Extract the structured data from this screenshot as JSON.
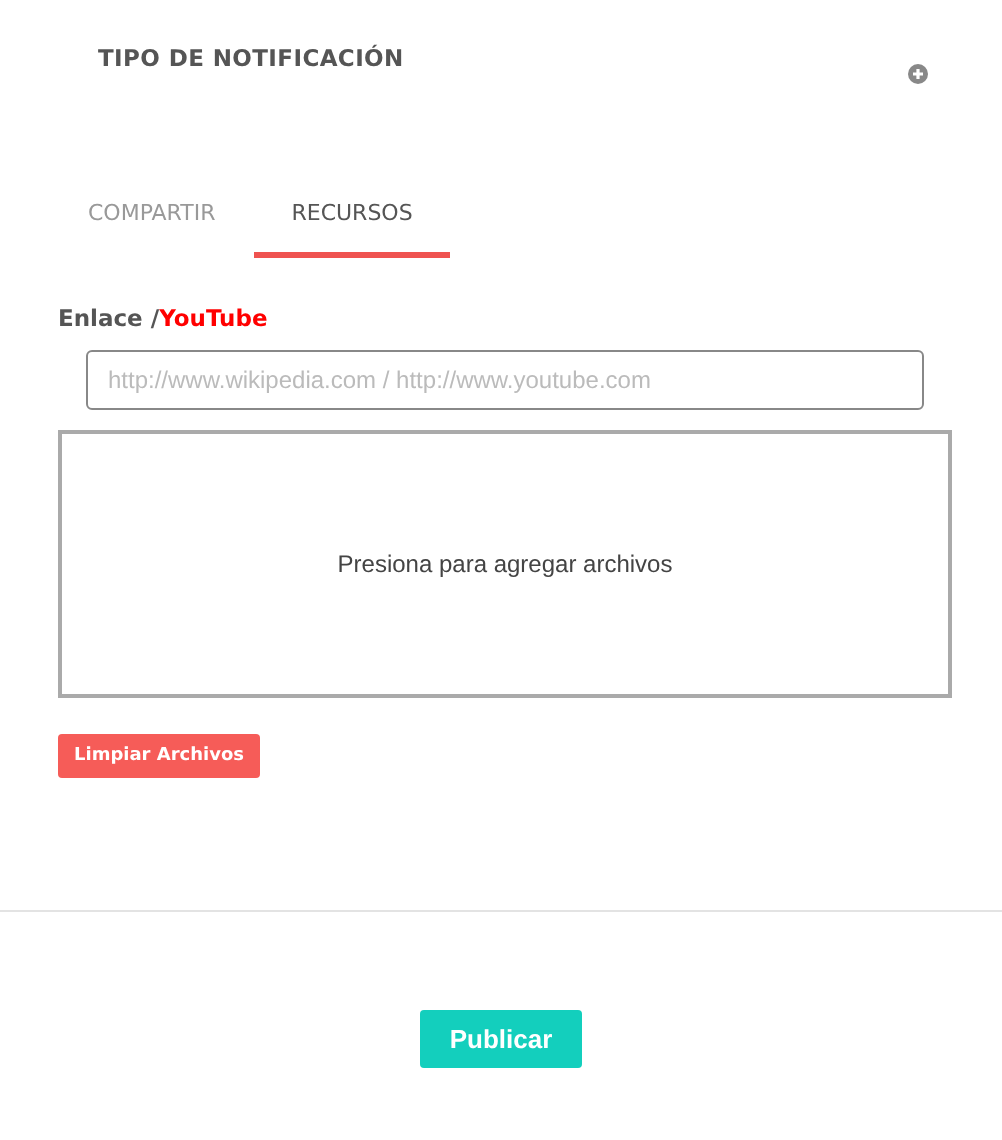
{
  "header": {
    "title": "TIPO DE NOTIFICACIÓN"
  },
  "tabs": [
    {
      "label": "COMPARTIR",
      "selected": false
    },
    {
      "label": "RECURSOS",
      "selected": true
    }
  ],
  "link_label": {
    "text": "Enlace /",
    "link": "YouTube"
  },
  "url_field": {
    "placeholder": "http://www.wikipedia.com / http://www.youtube.com"
  },
  "dropzone": {
    "text": "Presiona para agregar archivos"
  },
  "clear_button": "Limpiar Archivos",
  "publish_button": "Publicar"
}
